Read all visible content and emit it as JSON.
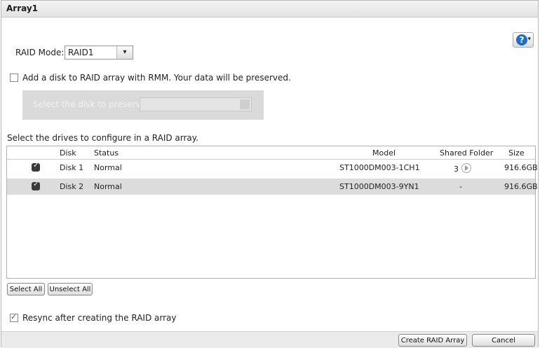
{
  "window": {
    "title": "Array1"
  },
  "help": {
    "icon": "help-icon",
    "glyph": "?",
    "caret": "▾"
  },
  "raid_mode": {
    "label": "RAID Mode:",
    "value": "RAID1",
    "arrow": "▾"
  },
  "rmm": {
    "label": "Add a disk to RAID array with RMM. Your data will be preserved.",
    "checked": false
  },
  "preserve": {
    "label": "Select the disk to preserve:",
    "value": ""
  },
  "drives": {
    "label": "Select the drives to configure in a RAID array.",
    "columns": [
      "Disk",
      "Status",
      "Model",
      "Shared Folder",
      "Size"
    ],
    "rows": [
      {
        "checked": true,
        "disk": "Disk 1",
        "status": "Normal",
        "model": "ST1000DM003-1CH1",
        "shared_folder": "3",
        "size": "916.6GB"
      },
      {
        "checked": true,
        "disk": "Disk 2",
        "status": "Normal",
        "model": "ST1000DM003-9YN1",
        "shared_folder": "-",
        "size": "916.6GB"
      }
    ]
  },
  "buttons": {
    "select_all": "Select All",
    "unselect_all": "Unselect All",
    "create": "Create RAID Array",
    "cancel": "Cancel"
  },
  "resync": {
    "label": "Resync after creating the RAID array",
    "checked": true
  }
}
